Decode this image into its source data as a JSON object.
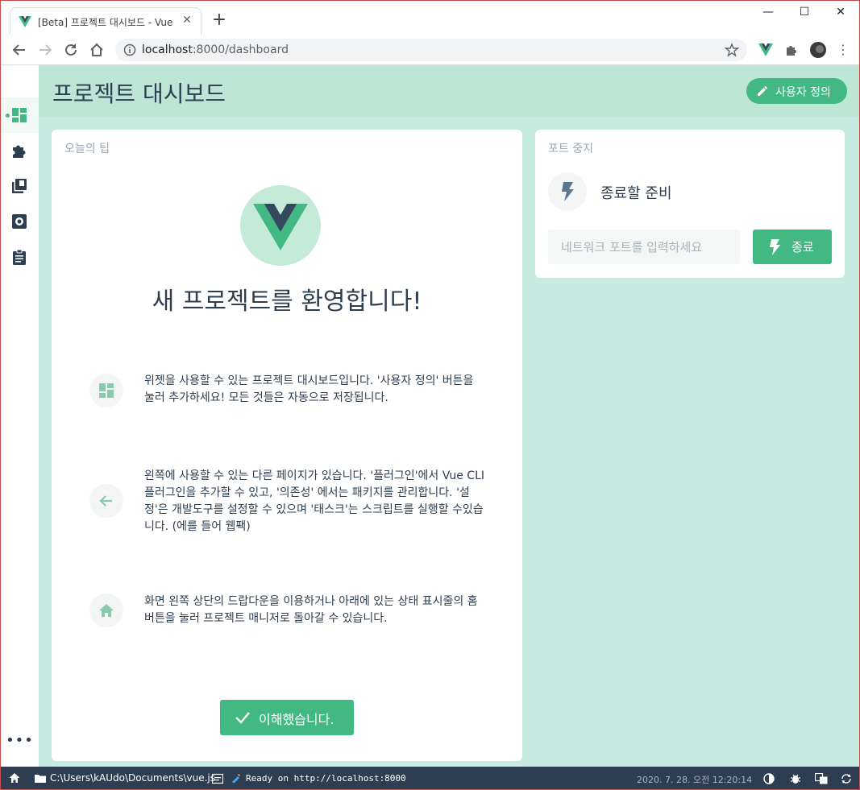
{
  "browser": {
    "tab_title": "[Beta] 프로젝트 대시보드 - Vue",
    "tab_close": "✕",
    "new_tab": "+",
    "url_host": "localhost",
    "url_rest": ":8000/dashboard",
    "window_controls": [
      "—",
      "☐",
      "✕"
    ]
  },
  "app": {
    "page_title": "프로젝트 대시보드",
    "customize_label": "사용자 정의",
    "sidebar_more": "•••"
  },
  "tips_card": {
    "title": "오늘의 팁",
    "welcome": "새 프로젝트를 환영합니다!",
    "tips": [
      {
        "icon": "dashboard-icon",
        "text": "위젯을 사용할 수 있는 프로젝트 대시보드입니다. '사용자 정의' 버튼을 눌러 추가하세요! 모든 것들은 자동으로 저장됩니다."
      },
      {
        "icon": "arrow-left-icon",
        "text": "왼쪽에 사용할 수 있는 다른 페이지가 있습니다. '플러그인'에서 Vue CLI 플러그인을 추가할 수 있고, '의존성' 에서는 패키지를 관리합니다. '설정'은 개발도구를 설정할 수 있으며 '태스크'는 스크립트를 실행할 수있습니다. (에를 들어 웹팩)"
      },
      {
        "icon": "home-icon",
        "text": "화면 왼쪽 상단의 드랍다운을 이용하거나 아래에 있는 상태 표시줄의 홈 버튼을 눌러 프로젝트 매니저로 돌아갈 수 있습니다."
      }
    ],
    "got_it_label": "이해했습니다."
  },
  "killport_card": {
    "title": "포트 중지",
    "status": "종료할 준비",
    "port_placeholder": "네트워크 포트를 입력하세요",
    "kill_label": "종료"
  },
  "statusbar": {
    "path": "C:\\Users\\kAUdo\\Documents\\vue.js",
    "log": "Ready on http://localhost:8000",
    "timestamp": "2020. 7. 28. 오전 12:20:14"
  },
  "colors": {
    "accent": "#42b983",
    "app_bg": "#c7ebe0",
    "header_bg": "#bde6d7",
    "text": "#2c3e50",
    "statusbar_bg": "#2c3e50"
  }
}
